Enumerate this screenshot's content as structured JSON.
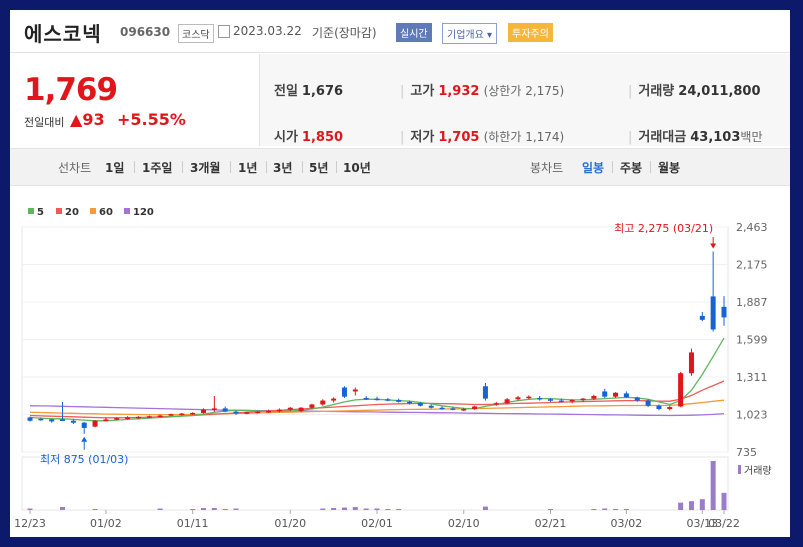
{
  "stock": {
    "name": "에스코넥",
    "code": "096630",
    "market": "코스닥",
    "date": "2023.03.22",
    "basis": "기준(장마감)",
    "realtime_label": "실시간",
    "company_label": "기업개요",
    "warning_label": "투자주의"
  },
  "price": {
    "current": "1,769",
    "change_label": "전일대비",
    "change_value": "93",
    "change_pct": "+5.55%"
  },
  "quote": {
    "prev_label": "전일",
    "prev": "1,676",
    "high_label": "고가",
    "high": "1,932",
    "upper_limit": "(상한가 2,175)",
    "volume_label": "거래량",
    "volume": "24,011,800",
    "open_label": "시가",
    "open": "1,850",
    "low_label": "저가",
    "low": "1,705",
    "lower_limit": "(하한가 1,174)",
    "amount_label": "거래대금",
    "amount": "43,103",
    "amount_unit": "백만"
  },
  "toolbar": {
    "line_label": "선차트",
    "periods": [
      "1일",
      "1주일",
      "3개월",
      "1년",
      "3년",
      "5년",
      "10년"
    ],
    "candle_label": "봉차트",
    "candle_periods": [
      "일봉",
      "주봉",
      "월봉"
    ],
    "active_candle": "일봉"
  },
  "colors": {
    "up": "#e0161b",
    "down": "#1763d6",
    "ma5": "#5cb85c",
    "ma20": "#f05a5a",
    "ma60": "#f59a3a",
    "ma120": "#a473d8",
    "volume": "#9a7cc8"
  },
  "chart_data": {
    "type": "candlestick",
    "legend": [
      "5",
      "20",
      "60",
      "120"
    ],
    "y_ticks": [
      "2,463",
      "2,175",
      "1,887",
      "1,599",
      "1,311",
      "1,023",
      "735"
    ],
    "ylim": [
      735,
      2463
    ],
    "x_ticks": [
      "12/23",
      "01/02",
      "01/11",
      "01/20",
      "02/01",
      "02/10",
      "02/21",
      "03/02",
      "03/13",
      "03/22"
    ],
    "high_annotation": "최고 2,275 (03/21)",
    "low_annotation": "최저 875 (01/03)",
    "volume_label": "거래량",
    "candles": [
      [
        1000,
        1007,
        968,
        975
      ],
      [
        990,
        1000,
        975,
        985
      ],
      [
        985,
        990,
        960,
        970
      ],
      [
        985,
        1120,
        975,
        980
      ],
      [
        975,
        990,
        950,
        960
      ],
      [
        960,
        965,
        875,
        920
      ],
      [
        930,
        980,
        925,
        975
      ],
      [
        980,
        1000,
        975,
        985
      ],
      [
        985,
        1002,
        980,
        995
      ],
      [
        995,
        1010,
        985,
        1000
      ],
      [
        1000,
        1010,
        990,
        1005
      ],
      [
        1005,
        1015,
        995,
        1010
      ],
      [
        1010,
        1020,
        1000,
        1015
      ],
      [
        1015,
        1030,
        1010,
        1025
      ],
      [
        1025,
        1035,
        1015,
        1030
      ],
      [
        1030,
        1040,
        1020,
        1035
      ],
      [
        1035,
        1070,
        1030,
        1060
      ],
      [
        1060,
        1165,
        1045,
        1070
      ],
      [
        1070,
        1085,
        1040,
        1045
      ],
      [
        1045,
        1055,
        1020,
        1030
      ],
      [
        1030,
        1045,
        1025,
        1040
      ],
      [
        1040,
        1050,
        1030,
        1045
      ],
      [
        1045,
        1060,
        1035,
        1050
      ],
      [
        1050,
        1070,
        1040,
        1060
      ],
      [
        1060,
        1080,
        1050,
        1075
      ],
      [
        1050,
        1080,
        1040,
        1075
      ],
      [
        1075,
        1105,
        1065,
        1100
      ],
      [
        1100,
        1140,
        1090,
        1130
      ],
      [
        1130,
        1155,
        1115,
        1145
      ],
      [
        1230,
        1240,
        1150,
        1160
      ],
      [
        1200,
        1230,
        1170,
        1215
      ],
      [
        1150,
        1165,
        1135,
        1145
      ],
      [
        1145,
        1160,
        1130,
        1140
      ],
      [
        1140,
        1150,
        1125,
        1135
      ],
      [
        1135,
        1145,
        1115,
        1120
      ],
      [
        1120,
        1130,
        1100,
        1110
      ],
      [
        1110,
        1120,
        1085,
        1090
      ],
      [
        1090,
        1100,
        1070,
        1075
      ],
      [
        1075,
        1085,
        1060,
        1070
      ],
      [
        1070,
        1080,
        1055,
        1060
      ],
      [
        1060,
        1075,
        1050,
        1065
      ],
      [
        1065,
        1090,
        1060,
        1085
      ],
      [
        1240,
        1265,
        1130,
        1145
      ],
      [
        1100,
        1120,
        1090,
        1110
      ],
      [
        1110,
        1150,
        1100,
        1140
      ],
      [
        1140,
        1165,
        1130,
        1155
      ],
      [
        1155,
        1170,
        1140,
        1160
      ],
      [
        1150,
        1165,
        1130,
        1140
      ],
      [
        1140,
        1150,
        1120,
        1130
      ],
      [
        1130,
        1145,
        1115,
        1125
      ],
      [
        1125,
        1140,
        1110,
        1135
      ],
      [
        1135,
        1150,
        1120,
        1145
      ],
      [
        1145,
        1175,
        1135,
        1165
      ],
      [
        1200,
        1220,
        1150,
        1160
      ],
      [
        1160,
        1195,
        1150,
        1190
      ],
      [
        1185,
        1200,
        1150,
        1155
      ],
      [
        1155,
        1160,
        1120,
        1130
      ],
      [
        1130,
        1140,
        1080,
        1090
      ],
      [
        1090,
        1100,
        1055,
        1065
      ],
      [
        1065,
        1090,
        1055,
        1080
      ],
      [
        1085,
        1350,
        1080,
        1340
      ],
      [
        1340,
        1530,
        1320,
        1500
      ],
      [
        1780,
        1810,
        1740,
        1750
      ],
      [
        1930,
        2275,
        1660,
        1676
      ],
      [
        1850,
        1932,
        1705,
        1769
      ]
    ],
    "volumes": [
      0.03,
      0,
      0,
      0.06,
      0,
      0,
      0.02,
      0,
      0,
      0,
      0,
      0,
      0.03,
      0,
      0,
      0.02,
      0.04,
      0.04,
      0.02,
      0.03,
      0,
      0,
      0,
      0,
      0,
      0,
      0,
      0.03,
      0.04,
      0.05,
      0.06,
      0.03,
      0.03,
      0.02,
      0.02,
      0,
      0,
      0,
      0,
      0,
      0,
      0,
      0.07,
      0,
      0,
      0,
      0,
      0,
      0.02,
      0,
      0,
      0,
      0.02,
      0.03,
      0.02,
      0.02,
      0,
      0,
      0,
      0,
      0.15,
      0.18,
      0.22,
      1.0,
      0.35
    ],
    "ma5": [
      1000,
      995,
      990,
      990,
      985,
      980,
      975,
      975,
      980,
      985,
      990,
      995,
      1000,
      1005,
      1010,
      1015,
      1025,
      1040,
      1050,
      1055,
      1055,
      1050,
      1045,
      1045,
      1050,
      1055,
      1065,
      1080,
      1100,
      1120,
      1135,
      1140,
      1140,
      1135,
      1130,
      1125,
      1115,
      1105,
      1090,
      1080,
      1070,
      1068,
      1085,
      1100,
      1115,
      1130,
      1140,
      1145,
      1145,
      1140,
      1135,
      1135,
      1140,
      1145,
      1150,
      1155,
      1150,
      1140,
      1120,
      1100,
      1130,
      1210,
      1330,
      1470,
      1610
    ],
    "ma20": [
      1015,
      1012,
      1010,
      1008,
      1005,
      1002,
      1000,
      998,
      998,
      999,
      1000,
      1002,
      1005,
      1008,
      1012,
      1015,
      1020,
      1025,
      1030,
      1035,
      1040,
      1045,
      1050,
      1055,
      1060,
      1065,
      1070,
      1075,
      1080,
      1085,
      1090,
      1095,
      1100,
      1103,
      1105,
      1107,
      1108,
      1108,
      1107,
      1105,
      1103,
      1100,
      1100,
      1102,
      1105,
      1108,
      1110,
      1112,
      1115,
      1118,
      1120,
      1122,
      1124,
      1126,
      1128,
      1130,
      1130,
      1128,
      1125,
      1125,
      1140,
      1170,
      1210,
      1245,
      1280
    ],
    "ma60": [
      1040,
      1038,
      1036,
      1034,
      1032,
      1030,
      1028,
      1026,
      1025,
      1024,
      1023,
      1022,
      1022,
      1022,
      1023,
      1024,
      1025,
      1027,
      1029,
      1031,
      1033,
      1035,
      1037,
      1039,
      1041,
      1043,
      1045,
      1047,
      1049,
      1051,
      1053,
      1055,
      1057,
      1059,
      1061,
      1062,
      1063,
      1064,
      1065,
      1066,
      1067,
      1068,
      1070,
      1072,
      1074,
      1076,
      1078,
      1080,
      1082,
      1084,
      1086,
      1088,
      1089,
      1090,
      1091,
      1092,
      1092,
      1092,
      1092,
      1093,
      1098,
      1106,
      1115,
      1124,
      1133
    ],
    "ma120": [
      1090,
      1089,
      1088,
      1086,
      1084,
      1082,
      1080,
      1078,
      1076,
      1074,
      1072,
      1070,
      1068,
      1066,
      1064,
      1062,
      1060,
      1058,
      1056,
      1055,
      1054,
      1053,
      1052,
      1051,
      1050,
      1049,
      1048,
      1047,
      1046,
      1045,
      1044,
      1043,
      1042,
      1041,
      1040,
      1039,
      1038,
      1037,
      1036,
      1035,
      1034,
      1033,
      1032,
      1031,
      1030,
      1029,
      1028,
      1027,
      1026,
      1025,
      1024,
      1023,
      1022,
      1021,
      1020,
      1019,
      1018,
      1017,
      1016,
      1015,
      1016,
      1018,
      1020,
      1024,
      1030
    ]
  }
}
